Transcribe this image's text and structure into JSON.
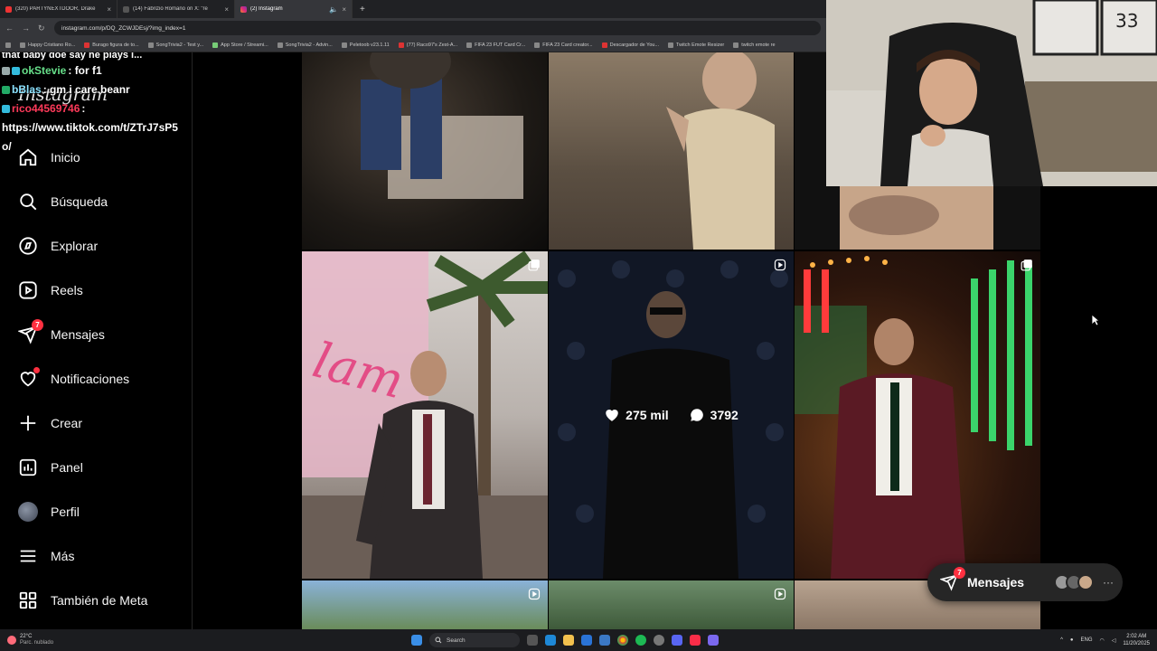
{
  "browser": {
    "tabs": [
      {
        "label": "(320) PARTYNEXTDOOR, Drake",
        "active": false
      },
      {
        "label": "(14) Fabrizio Romano on X: \"re",
        "active": false
      },
      {
        "label": "(2) Instagram",
        "active": true
      }
    ],
    "url": "instagram.com/p/DQ_ZCWJDEsj/?img_index=1",
    "bookmarks": [
      "Happy Cristiano Ro...",
      "Burago figura de to...",
      "SongTrivia2 - Test y...",
      "App Store / Streami...",
      "SongTrivia2 - Advin...",
      "Peletoob v23.1.11",
      "(77) Raco97's Zest-A...",
      "FIFA 23 FUT Card Cr...",
      "FIFA 23 Card creator...",
      "Descargador de You...",
      "Twitch Emote Resizer",
      "twitch emote re"
    ]
  },
  "sidebar": {
    "items": [
      {
        "label": "Inicio",
        "icon": "home-icon"
      },
      {
        "label": "Búsqueda",
        "icon": "search-icon"
      },
      {
        "label": "Explorar",
        "icon": "compass-icon"
      },
      {
        "label": "Reels",
        "icon": "reels-icon"
      },
      {
        "label": "Mensajes",
        "icon": "messenger-icon",
        "badge": "7"
      },
      {
        "label": "Notificaciones",
        "icon": "heart-icon"
      },
      {
        "label": "Crear",
        "icon": "plus-icon"
      },
      {
        "label": "Panel",
        "icon": "chart-icon"
      },
      {
        "label": "Perfil",
        "icon": "avatar"
      },
      {
        "label": "Más",
        "icon": "menu-icon"
      },
      {
        "label": "También de Meta",
        "icon": "meta-icon"
      }
    ]
  },
  "chat": {
    "partial_line": "that baby doe say he plays i...",
    "logo_text": "Instagram",
    "messages": [
      {
        "user": "okStevie",
        "text": ": for f1"
      },
      {
        "user": "bBlas",
        "text": ": gm i care beanr"
      },
      {
        "user": "rico44569746",
        "text": ":"
      }
    ],
    "link": "https://www.tiktok.com/t/ZTrJ7sP5",
    "link_cont": "o/"
  },
  "post_overlay": {
    "likes": "275 mil",
    "comments": "3792"
  },
  "messages_pill": {
    "label": "Mensajes",
    "badge": "7"
  },
  "taskbar": {
    "temperature": "22°C",
    "weather": "Parc. nublado",
    "search_placeholder": "Search",
    "lang": "ENG",
    "time": "2:02 AM",
    "date": "11/20/2025"
  },
  "colors": {
    "badge": "#ff3040",
    "bg": "#000000",
    "pill": "#262626"
  }
}
